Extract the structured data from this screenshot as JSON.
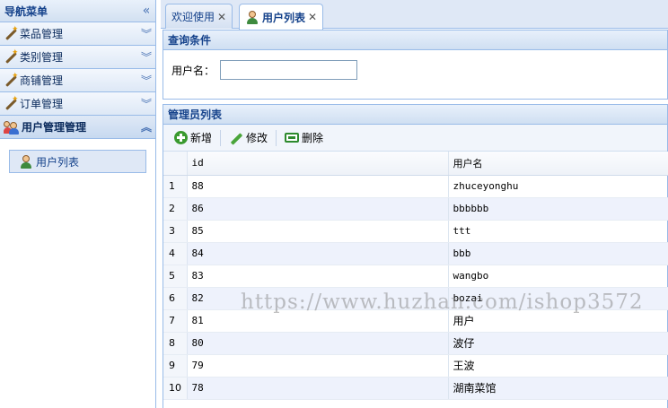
{
  "nav": {
    "title": "导航菜单",
    "collapse_icon": "double-chevron-left-icon",
    "items": [
      {
        "label": "菜品管理",
        "icon": "wand-icon"
      },
      {
        "label": "类别管理",
        "icon": "wand-icon"
      },
      {
        "label": "商铺管理",
        "icon": "wand-icon"
      },
      {
        "label": "订单管理",
        "icon": "wand-icon"
      },
      {
        "label": "用户管理管理",
        "icon": "users-icon",
        "expanded": true
      }
    ],
    "sub_items": [
      {
        "label": "用户列表",
        "icon": "user-icon"
      }
    ]
  },
  "tabs": [
    {
      "label": "欢迎使用",
      "active": false
    },
    {
      "label": "用户列表",
      "active": true
    }
  ],
  "query": {
    "title": "查询条件",
    "username_label": "用户名：",
    "username_value": ""
  },
  "list": {
    "title": "管理员列表",
    "toolbar": {
      "add": "新增",
      "edit": "修改",
      "delete": "删除"
    },
    "columns": [
      "id",
      "用户名"
    ],
    "rows": [
      {
        "n": "1",
        "id": "88",
        "name": "zhuceyonghu"
      },
      {
        "n": "2",
        "id": "86",
        "name": "bbbbbb"
      },
      {
        "n": "3",
        "id": "85",
        "name": "ttt"
      },
      {
        "n": "4",
        "id": "84",
        "name": "bbb"
      },
      {
        "n": "5",
        "id": "83",
        "name": "wangbo"
      },
      {
        "n": "6",
        "id": "82",
        "name": "bozai"
      },
      {
        "n": "7",
        "id": "81",
        "name": "用户"
      },
      {
        "n": "8",
        "id": "80",
        "name": "波仔"
      },
      {
        "n": "9",
        "id": "79",
        "name": "王波"
      },
      {
        "n": "10",
        "id": "78",
        "name": "湖南菜馆"
      }
    ]
  },
  "watermark": "https://www.huzhan.com/ishop3572",
  "colors": {
    "border": "#99bbe8",
    "header_text": "#15428b",
    "row_alt": "#eef2fc"
  }
}
